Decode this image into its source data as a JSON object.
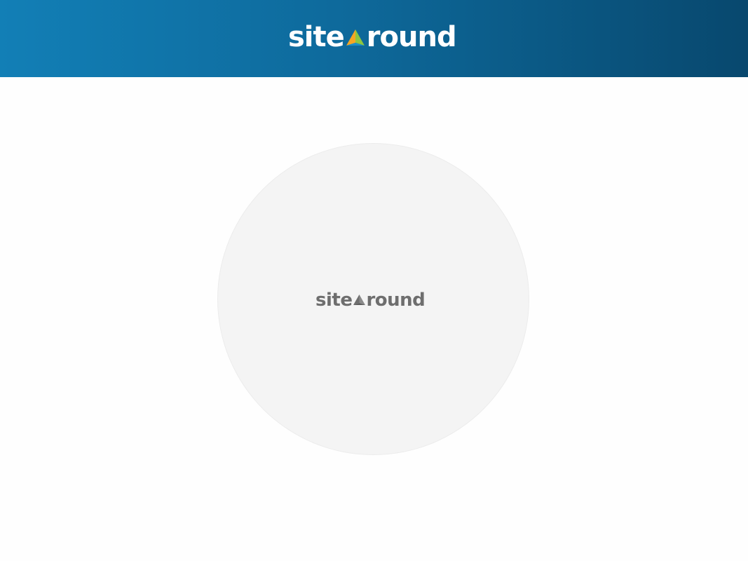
{
  "header": {
    "logo": {
      "prefix": "site",
      "suffix": "round",
      "mark_icon": "tri-color-triangle-icon",
      "text_color": "#ffffff",
      "mark_colors": [
        "#f5a623",
        "#8dc63f",
        "#0e6a9c"
      ]
    },
    "gradient": [
      "#127fb6",
      "#08486e"
    ]
  },
  "loader": {
    "logo": {
      "prefix": "site",
      "suffix": "round",
      "mark_icon": "triangle-icon",
      "text_color": "#6e6e6e"
    },
    "circle_color": "#f4f4f4"
  }
}
